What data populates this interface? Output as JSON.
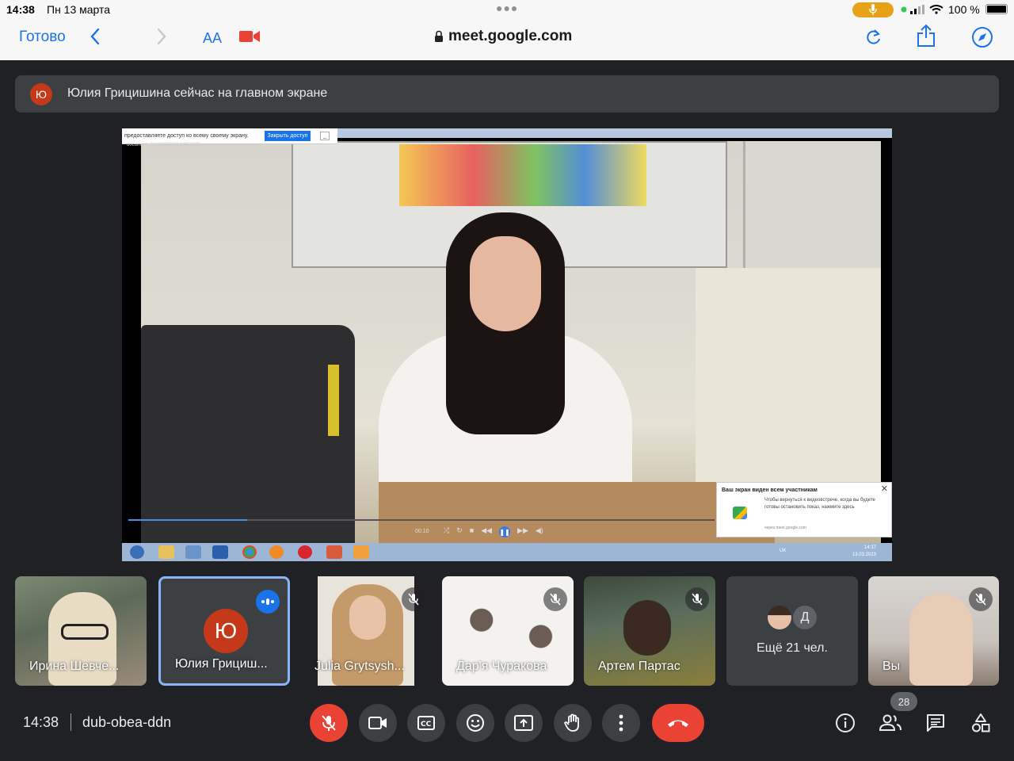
{
  "status_bar": {
    "time": "14:38",
    "date": "Пн 13 марта",
    "battery": "100 %"
  },
  "safari": {
    "done_label": "Готово",
    "text_size_label": "AA",
    "url": "meet.google.com"
  },
  "notice": {
    "avatar_letter": "Ю",
    "text": "Юлия Грицишина сейчас на главном экране"
  },
  "shared_screen": {
    "share_bar_text": "предоставляете доступ ко всему своему экрану.",
    "stop_share_label": "Закрыть доступ",
    "document_name": "document_5220083559133358095",
    "player_time": "00:10",
    "popup_title": "Ваш экран виден всем участникам",
    "popup_body": "Чтобы вернуться к видеовстрече, когда вы будете готовы остановить показ, нажмите здесь",
    "popup_via": "через meet.google.com",
    "taskbar_lang": "UK",
    "taskbar_time": "14:37",
    "taskbar_date": "13.03.2023"
  },
  "participants": [
    {
      "name": "Ирина Шевче...",
      "muted": false
    },
    {
      "name": "Юлия Грициш...",
      "avatar_letter": "Ю",
      "speaking": true
    },
    {
      "name": "Julia Grytsysh...",
      "muted": true
    },
    {
      "name": "Дар'я Чуракова",
      "muted": true
    },
    {
      "name": "Артем Партас",
      "muted": true
    },
    {
      "name": "Ещё 21 чел.",
      "avatar_letter": "Д"
    },
    {
      "name": "Вы",
      "muted": true
    }
  ],
  "bottom_bar": {
    "time": "14:38",
    "meeting_code": "dub-obea-ddn",
    "participant_count": "28"
  },
  "colors": {
    "accent": "#1a73e8",
    "danger": "#ea4335",
    "background": "#202124",
    "surface": "#3c4043"
  }
}
